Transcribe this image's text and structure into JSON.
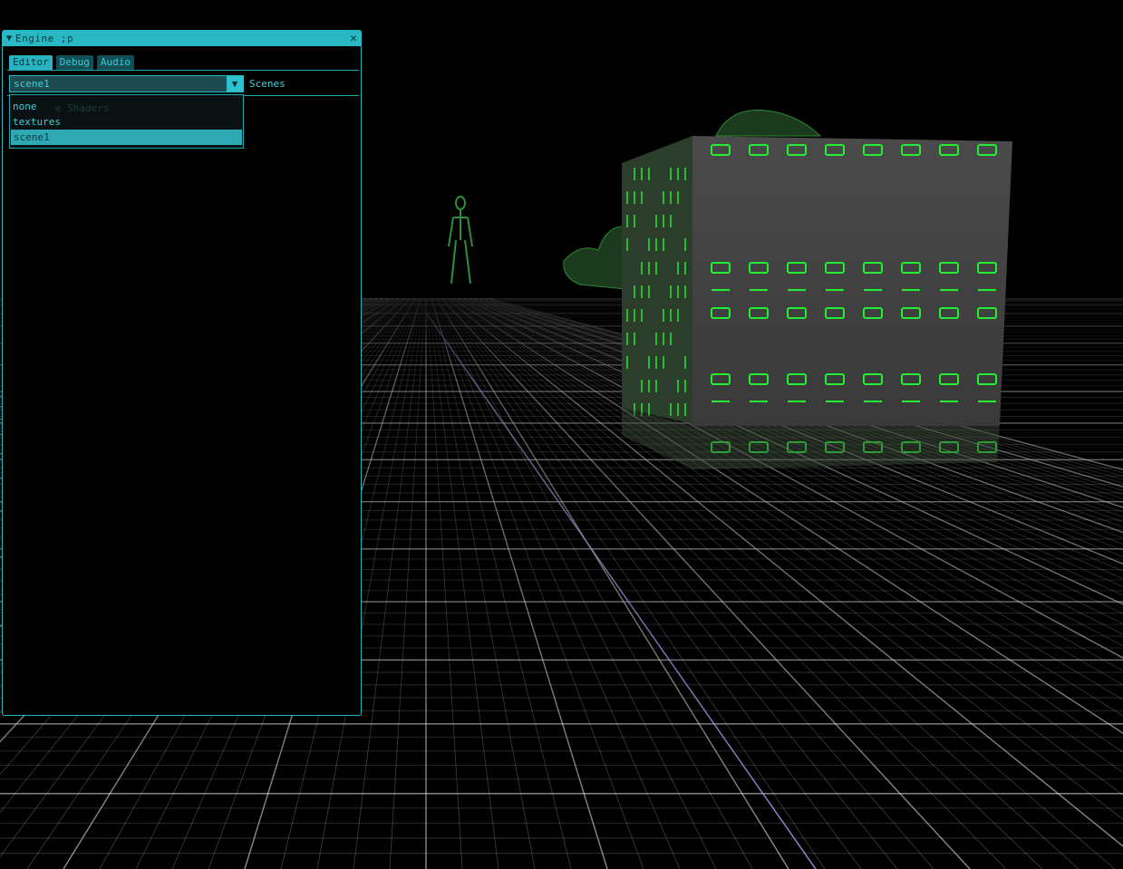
{
  "window": {
    "title": "Engine ;p",
    "collapse_icon": "triangle-down-icon",
    "close_icon": "close-icon"
  },
  "tabs": [
    {
      "label": "Editor",
      "active": true
    },
    {
      "label": "Debug",
      "active": false
    },
    {
      "label": "Audio",
      "active": false
    }
  ],
  "combo": {
    "value": "scene1",
    "label": "Scenes",
    "options": [
      "none",
      "textures",
      "scene1"
    ],
    "selected_index": 2
  },
  "obscured_text": "e Shaders",
  "colors": {
    "accent": "#2ab9c4",
    "text": "#3fd2da",
    "grid": "#ffffff",
    "cube_glow": "#22ff33"
  }
}
